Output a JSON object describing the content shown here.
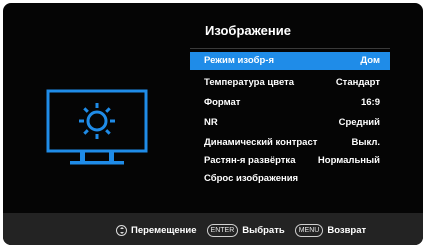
{
  "menu": {
    "title": "Изображение",
    "items": [
      {
        "label": "Режим изобр-я",
        "value": "Дом",
        "selected": true
      },
      {
        "label": "Температура цвета",
        "value": "Стандарт",
        "selected": false
      },
      {
        "label": "Формат",
        "value": "16:9",
        "selected": false
      },
      {
        "label": "NR",
        "value": "Средний",
        "selected": false
      },
      {
        "label": "Динамический контраст",
        "value": "Выкл.",
        "selected": false
      },
      {
        "label": "Растян-я развёртка",
        "value": "Нормальный",
        "selected": false
      },
      {
        "label": "Сброс изображения",
        "value": "",
        "selected": false
      }
    ]
  },
  "footer": {
    "navigate_label": "Перемещение",
    "enter_key": "ENTER",
    "select_label": "Выбрать",
    "menu_key": "MENU",
    "back_label": "Возврат"
  },
  "icon": {
    "name": "picture-settings-icon",
    "accent_color": "#1f8ce8"
  },
  "colors": {
    "selection": "#1f8ce8",
    "background": "#050505",
    "footer": "#232323"
  }
}
